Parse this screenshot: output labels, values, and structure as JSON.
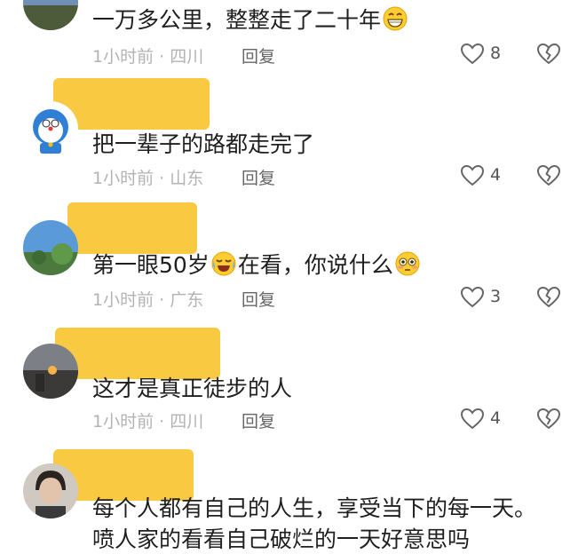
{
  "comments": [
    {
      "text": "一万多公里，整整走了二十年",
      "emoji_after": "grin-emoji",
      "time": "1小时前",
      "location": "四川",
      "reply_label": "回复",
      "likes": "8"
    },
    {
      "text": "把一辈子的路都走完了",
      "time": "1小时前",
      "location": "山东",
      "reply_label": "回复",
      "likes": "4"
    },
    {
      "text_a": "第一眼50岁",
      "text_b": "在看，你说什么",
      "time": "1小时前",
      "location": "广东",
      "reply_label": "回复",
      "likes": "3"
    },
    {
      "text": "这才是真正徒步的人",
      "time": "1小时前",
      "location": "四川",
      "reply_label": "回复",
      "likes": "4"
    },
    {
      "text_line1": "每个人都有自己的人生，享受当下的每一天。",
      "text_line2": "喷人家的看看自己破烂的一天好意思吗"
    }
  ],
  "colors": {
    "redaction": "#f7c431",
    "meta_text": "#b3b3b3",
    "reply_text": "#666666"
  }
}
